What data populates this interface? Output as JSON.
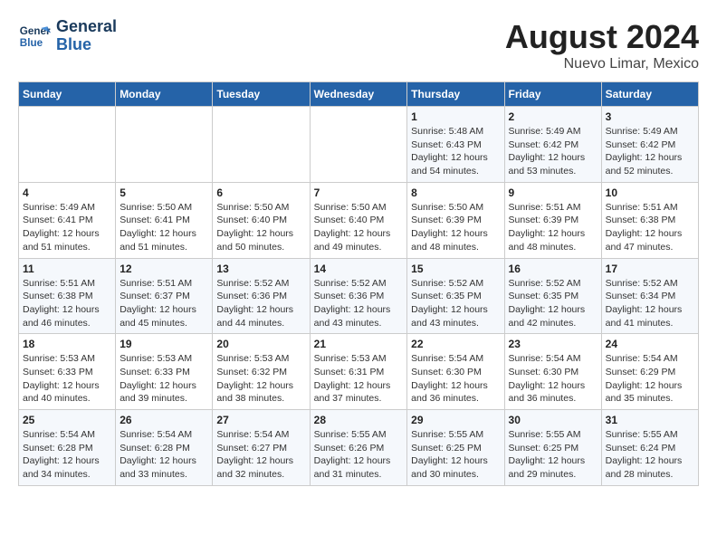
{
  "header": {
    "logo_line1": "General",
    "logo_line2": "Blue",
    "month_title": "August 2024",
    "location": "Nuevo Limar, Mexico"
  },
  "weekdays": [
    "Sunday",
    "Monday",
    "Tuesday",
    "Wednesday",
    "Thursday",
    "Friday",
    "Saturday"
  ],
  "weeks": [
    [
      {
        "day": "",
        "info": ""
      },
      {
        "day": "",
        "info": ""
      },
      {
        "day": "",
        "info": ""
      },
      {
        "day": "",
        "info": ""
      },
      {
        "day": "1",
        "info": "Sunrise: 5:48 AM\nSunset: 6:43 PM\nDaylight: 12 hours\nand 54 minutes."
      },
      {
        "day": "2",
        "info": "Sunrise: 5:49 AM\nSunset: 6:42 PM\nDaylight: 12 hours\nand 53 minutes."
      },
      {
        "day": "3",
        "info": "Sunrise: 5:49 AM\nSunset: 6:42 PM\nDaylight: 12 hours\nand 52 minutes."
      }
    ],
    [
      {
        "day": "4",
        "info": "Sunrise: 5:49 AM\nSunset: 6:41 PM\nDaylight: 12 hours\nand 51 minutes."
      },
      {
        "day": "5",
        "info": "Sunrise: 5:50 AM\nSunset: 6:41 PM\nDaylight: 12 hours\nand 51 minutes."
      },
      {
        "day": "6",
        "info": "Sunrise: 5:50 AM\nSunset: 6:40 PM\nDaylight: 12 hours\nand 50 minutes."
      },
      {
        "day": "7",
        "info": "Sunrise: 5:50 AM\nSunset: 6:40 PM\nDaylight: 12 hours\nand 49 minutes."
      },
      {
        "day": "8",
        "info": "Sunrise: 5:50 AM\nSunset: 6:39 PM\nDaylight: 12 hours\nand 48 minutes."
      },
      {
        "day": "9",
        "info": "Sunrise: 5:51 AM\nSunset: 6:39 PM\nDaylight: 12 hours\nand 48 minutes."
      },
      {
        "day": "10",
        "info": "Sunrise: 5:51 AM\nSunset: 6:38 PM\nDaylight: 12 hours\nand 47 minutes."
      }
    ],
    [
      {
        "day": "11",
        "info": "Sunrise: 5:51 AM\nSunset: 6:38 PM\nDaylight: 12 hours\nand 46 minutes."
      },
      {
        "day": "12",
        "info": "Sunrise: 5:51 AM\nSunset: 6:37 PM\nDaylight: 12 hours\nand 45 minutes."
      },
      {
        "day": "13",
        "info": "Sunrise: 5:52 AM\nSunset: 6:36 PM\nDaylight: 12 hours\nand 44 minutes."
      },
      {
        "day": "14",
        "info": "Sunrise: 5:52 AM\nSunset: 6:36 PM\nDaylight: 12 hours\nand 43 minutes."
      },
      {
        "day": "15",
        "info": "Sunrise: 5:52 AM\nSunset: 6:35 PM\nDaylight: 12 hours\nand 43 minutes."
      },
      {
        "day": "16",
        "info": "Sunrise: 5:52 AM\nSunset: 6:35 PM\nDaylight: 12 hours\nand 42 minutes."
      },
      {
        "day": "17",
        "info": "Sunrise: 5:52 AM\nSunset: 6:34 PM\nDaylight: 12 hours\nand 41 minutes."
      }
    ],
    [
      {
        "day": "18",
        "info": "Sunrise: 5:53 AM\nSunset: 6:33 PM\nDaylight: 12 hours\nand 40 minutes."
      },
      {
        "day": "19",
        "info": "Sunrise: 5:53 AM\nSunset: 6:33 PM\nDaylight: 12 hours\nand 39 minutes."
      },
      {
        "day": "20",
        "info": "Sunrise: 5:53 AM\nSunset: 6:32 PM\nDaylight: 12 hours\nand 38 minutes."
      },
      {
        "day": "21",
        "info": "Sunrise: 5:53 AM\nSunset: 6:31 PM\nDaylight: 12 hours\nand 37 minutes."
      },
      {
        "day": "22",
        "info": "Sunrise: 5:54 AM\nSunset: 6:30 PM\nDaylight: 12 hours\nand 36 minutes."
      },
      {
        "day": "23",
        "info": "Sunrise: 5:54 AM\nSunset: 6:30 PM\nDaylight: 12 hours\nand 36 minutes."
      },
      {
        "day": "24",
        "info": "Sunrise: 5:54 AM\nSunset: 6:29 PM\nDaylight: 12 hours\nand 35 minutes."
      }
    ],
    [
      {
        "day": "25",
        "info": "Sunrise: 5:54 AM\nSunset: 6:28 PM\nDaylight: 12 hours\nand 34 minutes."
      },
      {
        "day": "26",
        "info": "Sunrise: 5:54 AM\nSunset: 6:28 PM\nDaylight: 12 hours\nand 33 minutes."
      },
      {
        "day": "27",
        "info": "Sunrise: 5:54 AM\nSunset: 6:27 PM\nDaylight: 12 hours\nand 32 minutes."
      },
      {
        "day": "28",
        "info": "Sunrise: 5:55 AM\nSunset: 6:26 PM\nDaylight: 12 hours\nand 31 minutes."
      },
      {
        "day": "29",
        "info": "Sunrise: 5:55 AM\nSunset: 6:25 PM\nDaylight: 12 hours\nand 30 minutes."
      },
      {
        "day": "30",
        "info": "Sunrise: 5:55 AM\nSunset: 6:25 PM\nDaylight: 12 hours\nand 29 minutes."
      },
      {
        "day": "31",
        "info": "Sunrise: 5:55 AM\nSunset: 6:24 PM\nDaylight: 12 hours\nand 28 minutes."
      }
    ]
  ]
}
